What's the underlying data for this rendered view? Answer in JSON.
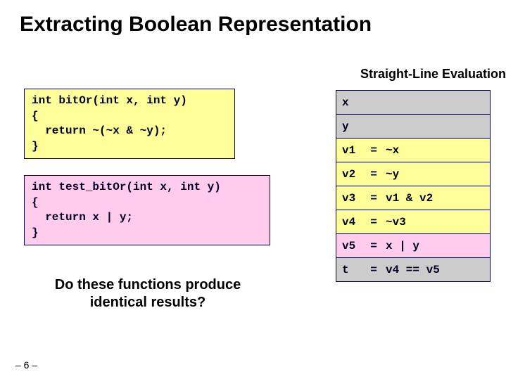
{
  "title": "Extracting Boolean Representation",
  "subtitle": "Straight-Line Evaluation",
  "code1": "int bitOr(int x, int y)\n{\n  return ~(~x & ~y);\n}",
  "code2": "int test_bitOr(int x, int y)\n{\n  return x | y;\n}",
  "question_line1": "Do these functions produce",
  "question_line2": "identical results?",
  "pagenum": "– 6 –",
  "rows": [
    {
      "bg": "bg-gray",
      "var": "x",
      "eq": "",
      "expr": ""
    },
    {
      "bg": "bg-gray",
      "var": "y",
      "eq": "",
      "expr": ""
    },
    {
      "bg": "bg-yellow",
      "var": "v1",
      "eq": "=",
      "expr": "~x"
    },
    {
      "bg": "bg-yellow",
      "var": "v2",
      "eq": "=",
      "expr": "~y"
    },
    {
      "bg": "bg-yellow",
      "var": "v3",
      "eq": "=",
      "expr": "v1 & v2"
    },
    {
      "bg": "bg-yellow",
      "var": "v4",
      "eq": "=",
      "expr": "~v3"
    },
    {
      "bg": "bg-pink",
      "var": "v5",
      "eq": "=",
      "expr": "x | y"
    },
    {
      "bg": "bg-gray",
      "var": "t",
      "eq": "=",
      "expr": "v4 == v5"
    }
  ]
}
